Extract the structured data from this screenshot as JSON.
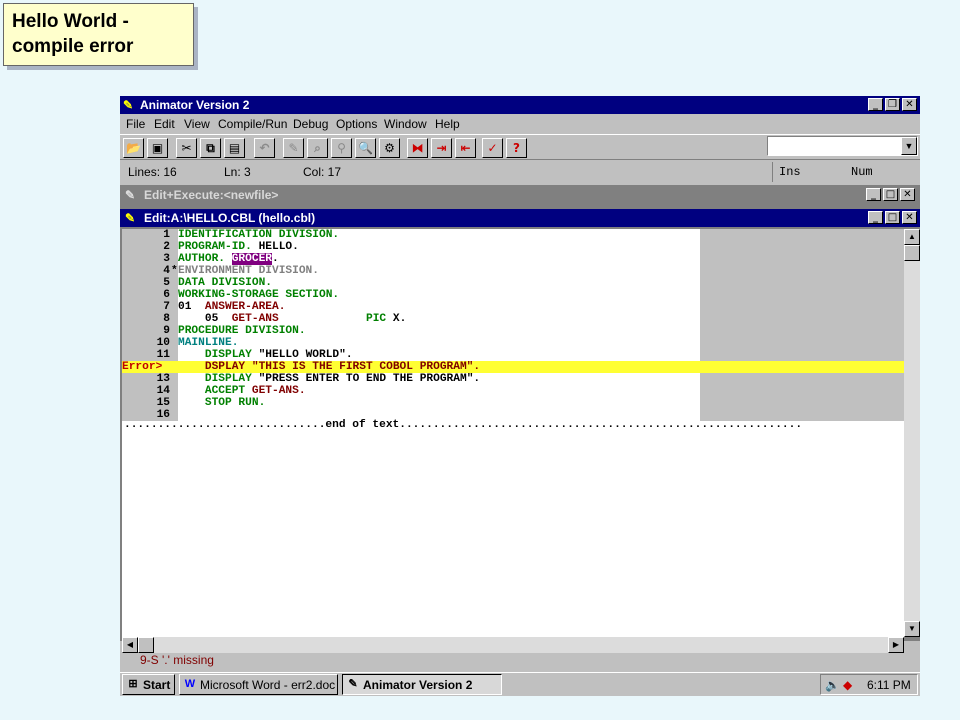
{
  "slide": {
    "title": "Hello World - compile error"
  },
  "app": {
    "title": "Animator Version 2"
  },
  "menu": [
    "File",
    "Edit",
    "View",
    "Compile/Run",
    "Debug",
    "Options",
    "Window",
    "Help"
  ],
  "status": {
    "lines": "Lines: 16",
    "ln": "Ln: 3",
    "col": "Col: 17",
    "ins": "Ins",
    "num": "Num"
  },
  "windows": {
    "execute": "Edit+Execute:<newfile>",
    "editor": "Edit:A:\\HELLO.CBL (hello.cbl)"
  },
  "code": [
    {
      "n": "1",
      "t": "IDENTIFICATION DIVISION."
    },
    {
      "n": "2",
      "t": "PROGRAM-ID. HELLO."
    },
    {
      "n": "3",
      "t": "AUTHOR. GROCER."
    },
    {
      "n": "4",
      "t": "ENVIRONMENT DIVISION."
    },
    {
      "n": "5",
      "t": "DATA DIVISION."
    },
    {
      "n": "6",
      "t": "WORKING-STORAGE SECTION."
    },
    {
      "n": "7",
      "t": "01  ANSWER-AREA."
    },
    {
      "n": "8",
      "t": "    05  GET-ANS             PIC X."
    },
    {
      "n": "9",
      "t": "PROCEDURE DIVISION."
    },
    {
      "n": "10",
      "t": "MAINLINE."
    },
    {
      "n": "11",
      "t": "    DISPLAY \"HELLO WORLD\"."
    },
    {
      "n": "Error>",
      "t": "    DSPLAY \"THIS IS THE FIRST COBOL PROGRAM\"."
    },
    {
      "n": "13",
      "t": "    DISPLAY \"PRESS ENTER TO END THE PROGRAM\"."
    },
    {
      "n": "14",
      "t": "    ACCEPT GET-ANS."
    },
    {
      "n": "15",
      "t": "    STOP RUN."
    },
    {
      "n": "16",
      "t": ""
    }
  ],
  "eot": "..............................end of text............................................................",
  "message": "9-S '.' missing",
  "taskbar": {
    "start": "Start",
    "word": "Microsoft Word - err2.doc",
    "animator": "Animator Version 2",
    "time": "6:11 PM"
  },
  "colors": {
    "titlebar": "#000080",
    "error_highlight": "#ffff33",
    "keyword": "#008000",
    "identifier": "#800000"
  }
}
